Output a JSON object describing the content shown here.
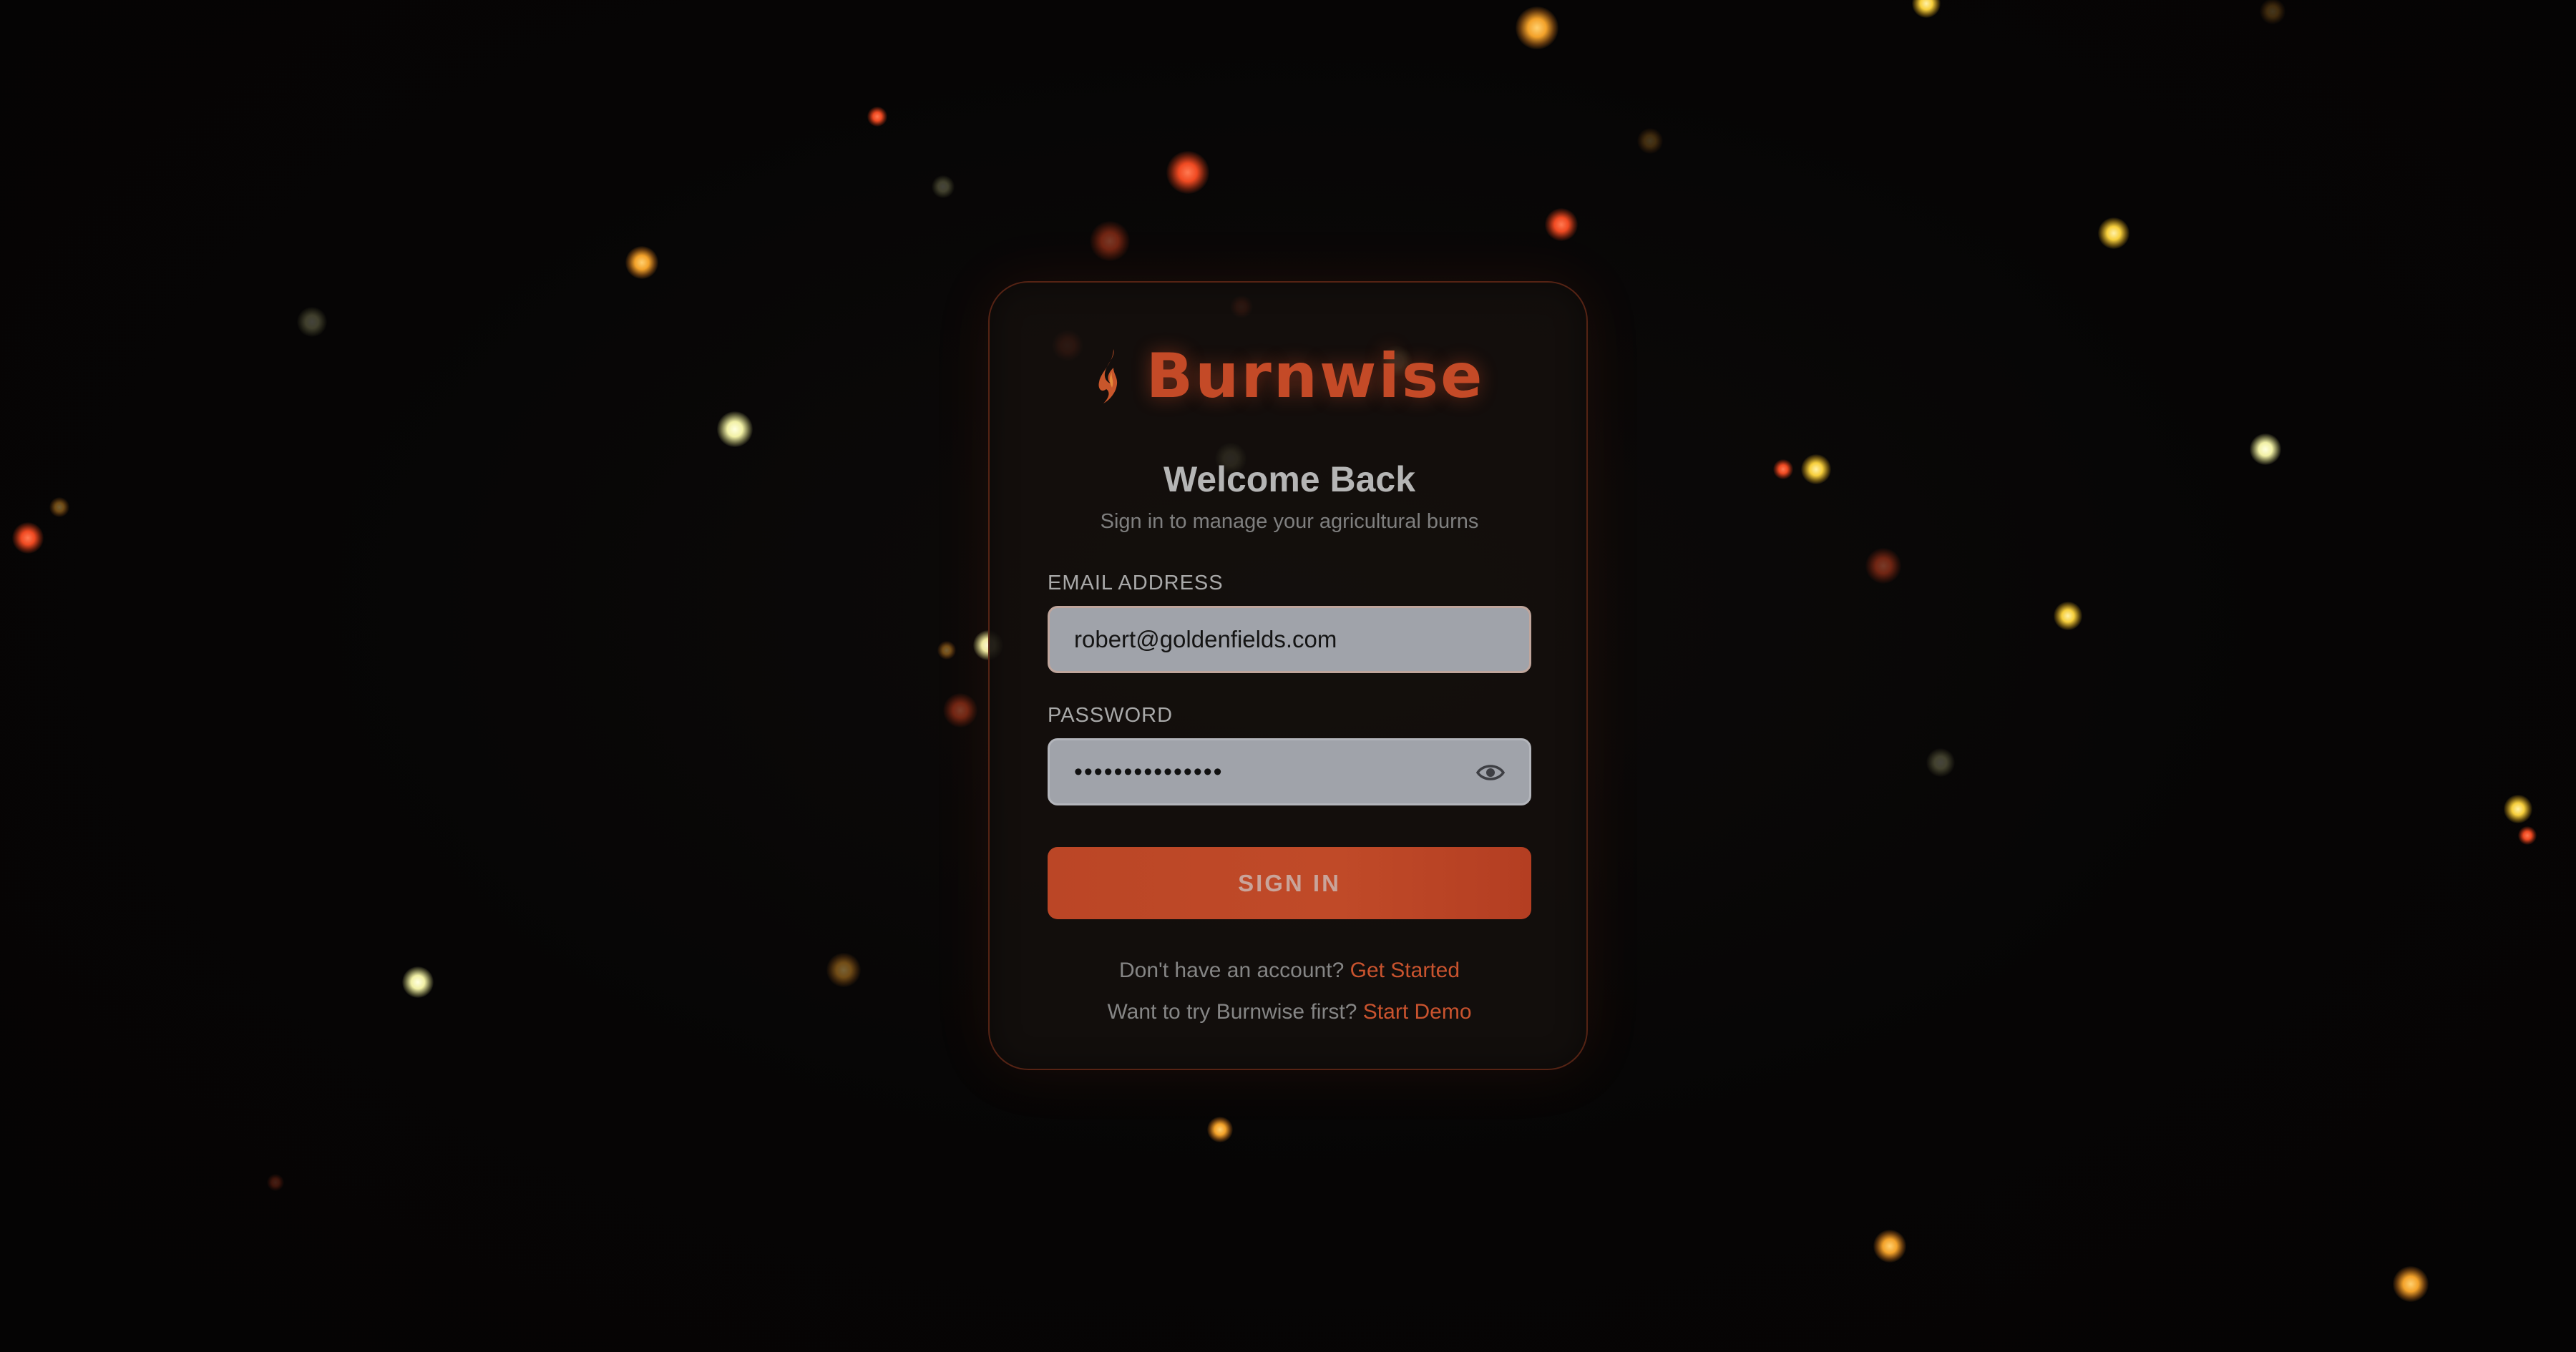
{
  "brand": {
    "name": "Burnwise",
    "logo_icon": "flame-icon"
  },
  "login": {
    "title": "Welcome Back",
    "subtitle": "Sign in to manage your agricultural burns",
    "email_label": "EMAIL ADDRESS",
    "email_value": "robert@goldenfields.com",
    "password_label": "PASSWORD",
    "password_mask": "•••••••••••••••",
    "password_toggle_icon": "eye-icon",
    "signin_label": "SIGN IN",
    "signup_prompt": "Don't have an account?",
    "signup_link": "Get Started",
    "demo_prompt": "Want to try Burnwise first?",
    "demo_link": "Start Demo"
  },
  "colors": {
    "background": "#060505",
    "brand_accent": "#c44a27",
    "button": "#bb4626",
    "link": "#c9532e",
    "input_fill": "#a0a3aa"
  }
}
